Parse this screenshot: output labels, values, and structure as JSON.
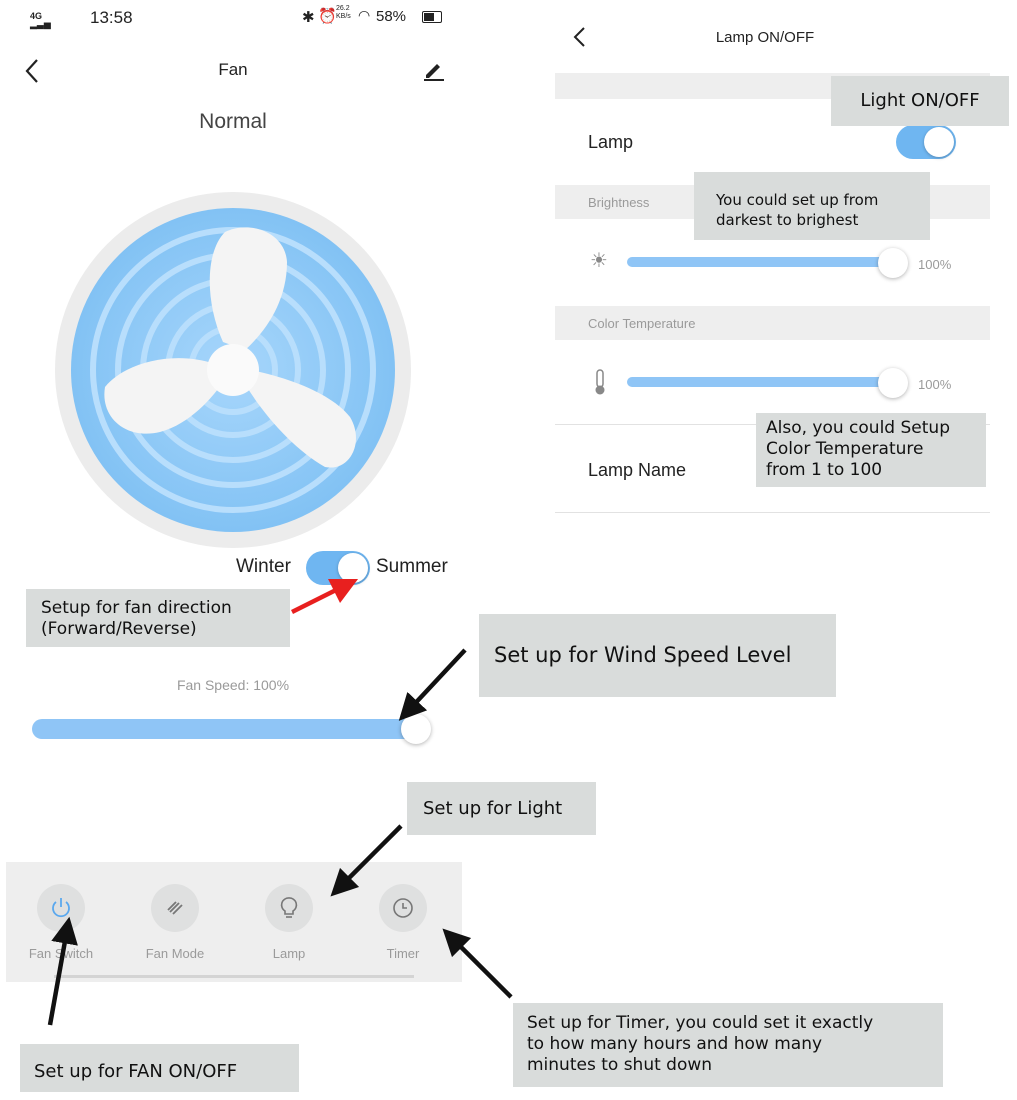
{
  "status_bar": {
    "network": "4G",
    "time": "13:58",
    "speed": "26.2 KB/s",
    "battery": "58%"
  },
  "fan_screen": {
    "title": "Fan",
    "mode": "Normal",
    "direction_left": "Winter",
    "direction_right": "Summer",
    "speed_label": "Fan Speed: 100%",
    "speed_fraction": 1.0,
    "tabs": [
      {
        "label": "Fan Switch"
      },
      {
        "label": "Fan Mode"
      },
      {
        "label": "Lamp"
      },
      {
        "label": "Timer"
      }
    ]
  },
  "lamp_screen": {
    "title": "Lamp ON/OFF",
    "lamp_label": "Lamp",
    "brightness_header": "Brightness",
    "brightness_value": "100%",
    "color_temp_header": "Color Temperature",
    "color_temp_value": "100%",
    "lamp_name_label": "Lamp Name"
  },
  "annotations": {
    "light_toggle": "Light ON/OFF",
    "brightness_line1": "You could set up from",
    "brightness_line2": "darkest to brighest",
    "colortemp_line1": "Also, you could Setup",
    "colortemp_line2": "Color Temperature",
    "colortemp_line3": "from 1 to 100",
    "fan_dir_line1": "Setup for fan direction",
    "fan_dir_line2": "(Forward/Reverse)",
    "wind_speed": "Set up for Wind Speed Level",
    "light": "Set up for Light",
    "timer_line1": "Set up for Timer, you could set it exactly",
    "timer_line2": "to how many hours and how many",
    "timer_line3": "minutes to shut down",
    "fan_onoff": "Set up for FAN ON/OFF"
  },
  "colors": {
    "accent": "#6fb6f1",
    "callout_bg": "#d9dcdb",
    "arrow_black": "#111111",
    "arrow_red": "#e8201f"
  }
}
